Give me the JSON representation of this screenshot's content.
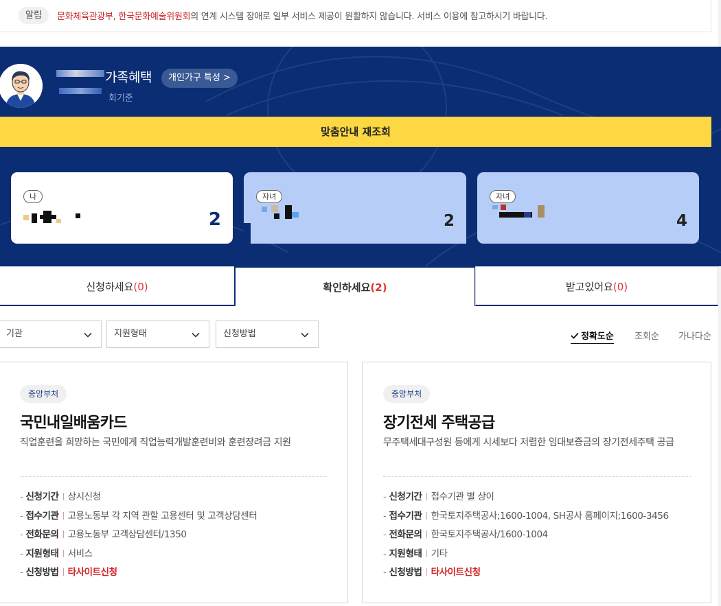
{
  "notice": {
    "tag": "알림",
    "org1": "문화체육관광부",
    "comma": ", ",
    "org2": "한국문화예술위원회",
    "rest": "의 연계 시스템 장애로 일부 서비스 제공이 원활하지 않습니다. 서비스 이용에 참고하시기 바랍니다."
  },
  "hero": {
    "family_title": "가족혜택",
    "trait_button": "개인가구 특성 >",
    "sub_name": "회기준",
    "requery_button": "맞춤안내 재조회",
    "members": [
      {
        "relation": "나",
        "count": "2"
      },
      {
        "relation": "자녀",
        "count": "2"
      },
      {
        "relation": "자녀",
        "count": "4"
      }
    ]
  },
  "tabs": [
    {
      "label": "신청하세요",
      "count": "(0)"
    },
    {
      "label": "확인하세요",
      "count": "(2)"
    },
    {
      "label": "받고있어요",
      "count": "(0)"
    }
  ],
  "filters": [
    {
      "selected": "기관"
    },
    {
      "selected": "지원형태"
    },
    {
      "selected": "신청방법"
    }
  ],
  "sort": {
    "accuracy": "정확도순",
    "views": "조회순",
    "alpha": "가나다순"
  },
  "cards": [
    {
      "badge": "중앙부처",
      "title": "국민내일배움카드",
      "desc": "직업훈련을 희망하는 국민에게 직업능력개발훈련비와 훈련장려금 지원",
      "rows": [
        {
          "label": "신청기간",
          "value": "상시신청"
        },
        {
          "label": "접수기관",
          "value": "고용노동부 각 지역 관할 고용센터 및 고객상담센터"
        },
        {
          "label": "전화문의",
          "value": "고용노동부 고객상담센터/1350"
        },
        {
          "label": "지원형태",
          "value": "서비스"
        },
        {
          "label": "신청방법",
          "value": "타사이트신청"
        }
      ]
    },
    {
      "badge": "중앙부처",
      "title": "장기전세 주택공급",
      "desc": "무주택세대구성원 등에게 시세보다 저렴한 임대보증금의 장기전세주택 공급",
      "rows": [
        {
          "label": "신청기간",
          "value": "접수기관 별 상이"
        },
        {
          "label": "접수기관",
          "value": "한국토지주택공사;1600-1004, SH공사 홈페이지;1600-3456"
        },
        {
          "label": "전화문의",
          "value": "한국토지주택공사/1600-1004"
        },
        {
          "label": "지원형태",
          "value": "기타"
        },
        {
          "label": "신청방법",
          "value": "타사이트신청"
        }
      ]
    }
  ],
  "colors": {
    "navy": "#0b2d74",
    "yellow": "#fdd843",
    "light_blue": "#b6cef7",
    "red": "#d3262b"
  },
  "icons": {
    "chevron": "chevron-down-icon",
    "check": "check-icon",
    "avatar": "avatar-icon"
  }
}
